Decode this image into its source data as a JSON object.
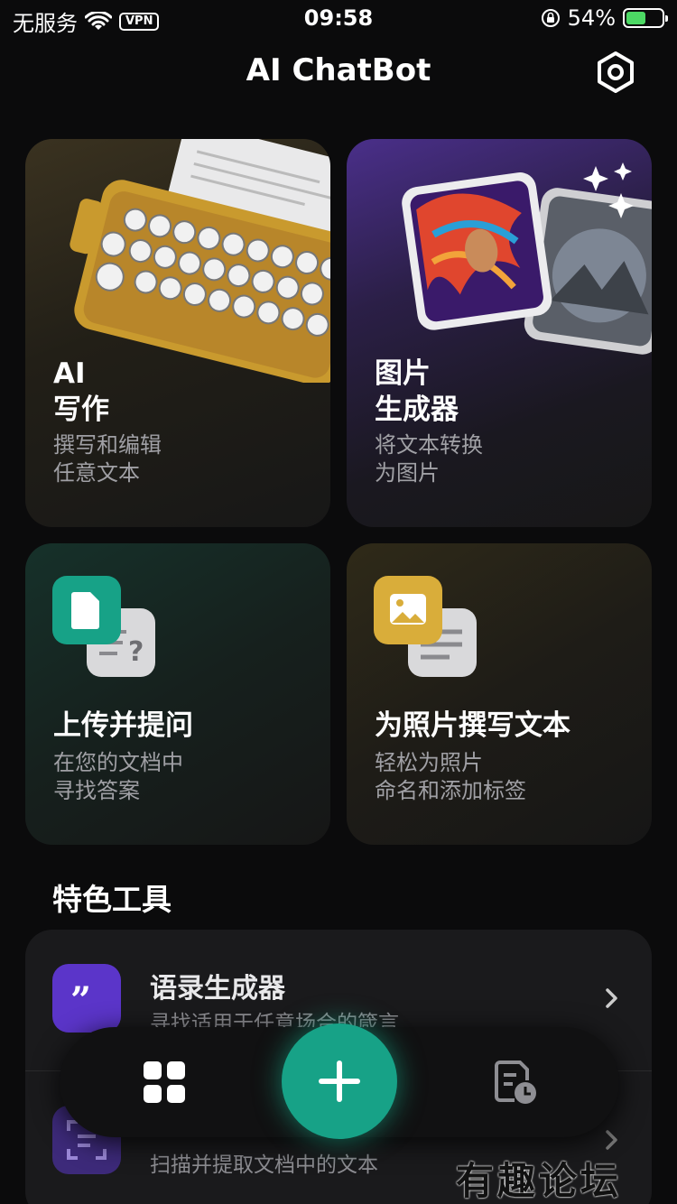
{
  "status_bar": {
    "carrier": "无服务",
    "vpn": "VPN",
    "time": "09:58",
    "battery": "54%",
    "battery_level": 0.54
  },
  "header": {
    "title": "AI ChatBot"
  },
  "cards": [
    {
      "title_line1": "AI",
      "title_line2": "写作",
      "sub_line1": "撰写和编辑",
      "sub_line2": "任意文本"
    },
    {
      "title_line1": "图片",
      "title_line2": "生成器",
      "sub_line1": "将文本转换",
      "sub_line2": "为图片"
    },
    {
      "title": "上传并提问",
      "sub_line1": "在您的文档中",
      "sub_line2": "寻找答案"
    },
    {
      "title": "为照片撰写文本",
      "sub_line1": "轻松为照片",
      "sub_line2": "命名和添加标签"
    }
  ],
  "section": {
    "title": "特色工具"
  },
  "tools": [
    {
      "title": "语录生成器",
      "subtitle": "寻找适用于任意场合的箴言"
    },
    {
      "title": "",
      "subtitle": "扫描并提取文档中的文本"
    }
  ],
  "watermark": "有趣论坛",
  "colors": {
    "accent": "#17a287",
    "tool_icon": "#5b35c9"
  }
}
